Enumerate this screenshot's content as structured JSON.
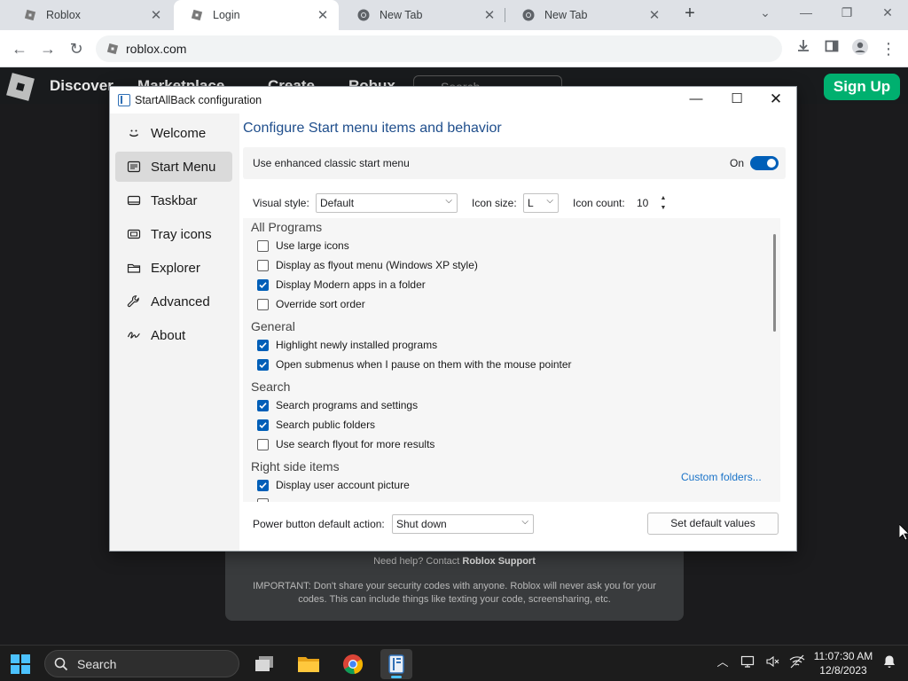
{
  "browser": {
    "tabs": [
      {
        "title": "Roblox",
        "icon": "roblox-icon"
      },
      {
        "title": "Login",
        "icon": "roblox-icon"
      },
      {
        "title": "New Tab",
        "icon": "chrome-icon"
      },
      {
        "title": "New Tab",
        "icon": "chrome-icon"
      }
    ],
    "active_tab": 1,
    "url": "roblox.com"
  },
  "roblox": {
    "nav": [
      "Discover",
      "Marketplace",
      "Create",
      "Robux"
    ],
    "search_placeholder": "Search",
    "signup": "Sign Up",
    "help_prefix": "Need help? Contact ",
    "help_link": "Roblox Support",
    "important": "IMPORTANT: Don't share your security codes with anyone. Roblox will never ask you for your codes. This can include things like texting your code, screensharing, etc."
  },
  "dialog": {
    "title": "StartAllBack configuration",
    "sidebar": [
      {
        "label": "Welcome",
        "icon": "smile-icon"
      },
      {
        "label": "Start Menu",
        "icon": "start-menu-icon",
        "active": true
      },
      {
        "label": "Taskbar",
        "icon": "taskbar-icon"
      },
      {
        "label": "Tray icons",
        "icon": "tray-icon"
      },
      {
        "label": "Explorer",
        "icon": "folder-icon"
      },
      {
        "label": "Advanced",
        "icon": "wrench-icon"
      },
      {
        "label": "About",
        "icon": "signature-icon"
      }
    ],
    "heading": "Configure Start menu items and behavior",
    "enhanced_label": "Use enhanced classic start menu",
    "enhanced_state": "On",
    "visual_style_label": "Visual style:",
    "visual_style_value": "Default",
    "icon_size_label": "Icon size:",
    "icon_size_value": "L",
    "icon_count_label": "Icon count:",
    "icon_count_value": "10",
    "sections": [
      {
        "title": "All Programs",
        "items": [
          {
            "label": "Use large icons",
            "checked": false
          },
          {
            "label": "Display as flyout menu (Windows XP style)",
            "checked": false
          },
          {
            "label": "Display Modern apps in a folder",
            "checked": true
          },
          {
            "label": "Override sort order",
            "checked": false
          }
        ]
      },
      {
        "title": "General",
        "items": [
          {
            "label": "Highlight newly installed programs",
            "checked": true
          },
          {
            "label": "Open submenus when I pause on them with the mouse pointer",
            "checked": true
          }
        ]
      },
      {
        "title": "Search",
        "items": [
          {
            "label": "Search programs and settings",
            "checked": true
          },
          {
            "label": "Search public folders",
            "checked": true
          },
          {
            "label": "Use search flyout for more results",
            "checked": false
          }
        ]
      },
      {
        "title": "Right side items",
        "items": [
          {
            "label": "Display user account picture",
            "checked": true
          }
        ]
      }
    ],
    "custom_folders_link": "Custom folders...",
    "power_label": "Power button default action:",
    "power_value": "Shut down",
    "set_default_button": "Set default values"
  },
  "taskbar": {
    "search_label": "Search",
    "time": "11:07:30 AM",
    "date": "12/8/2023"
  },
  "colors": {
    "accent": "#005fb8",
    "heading": "#1f4e8c",
    "roblox_green": "#00b06f"
  }
}
